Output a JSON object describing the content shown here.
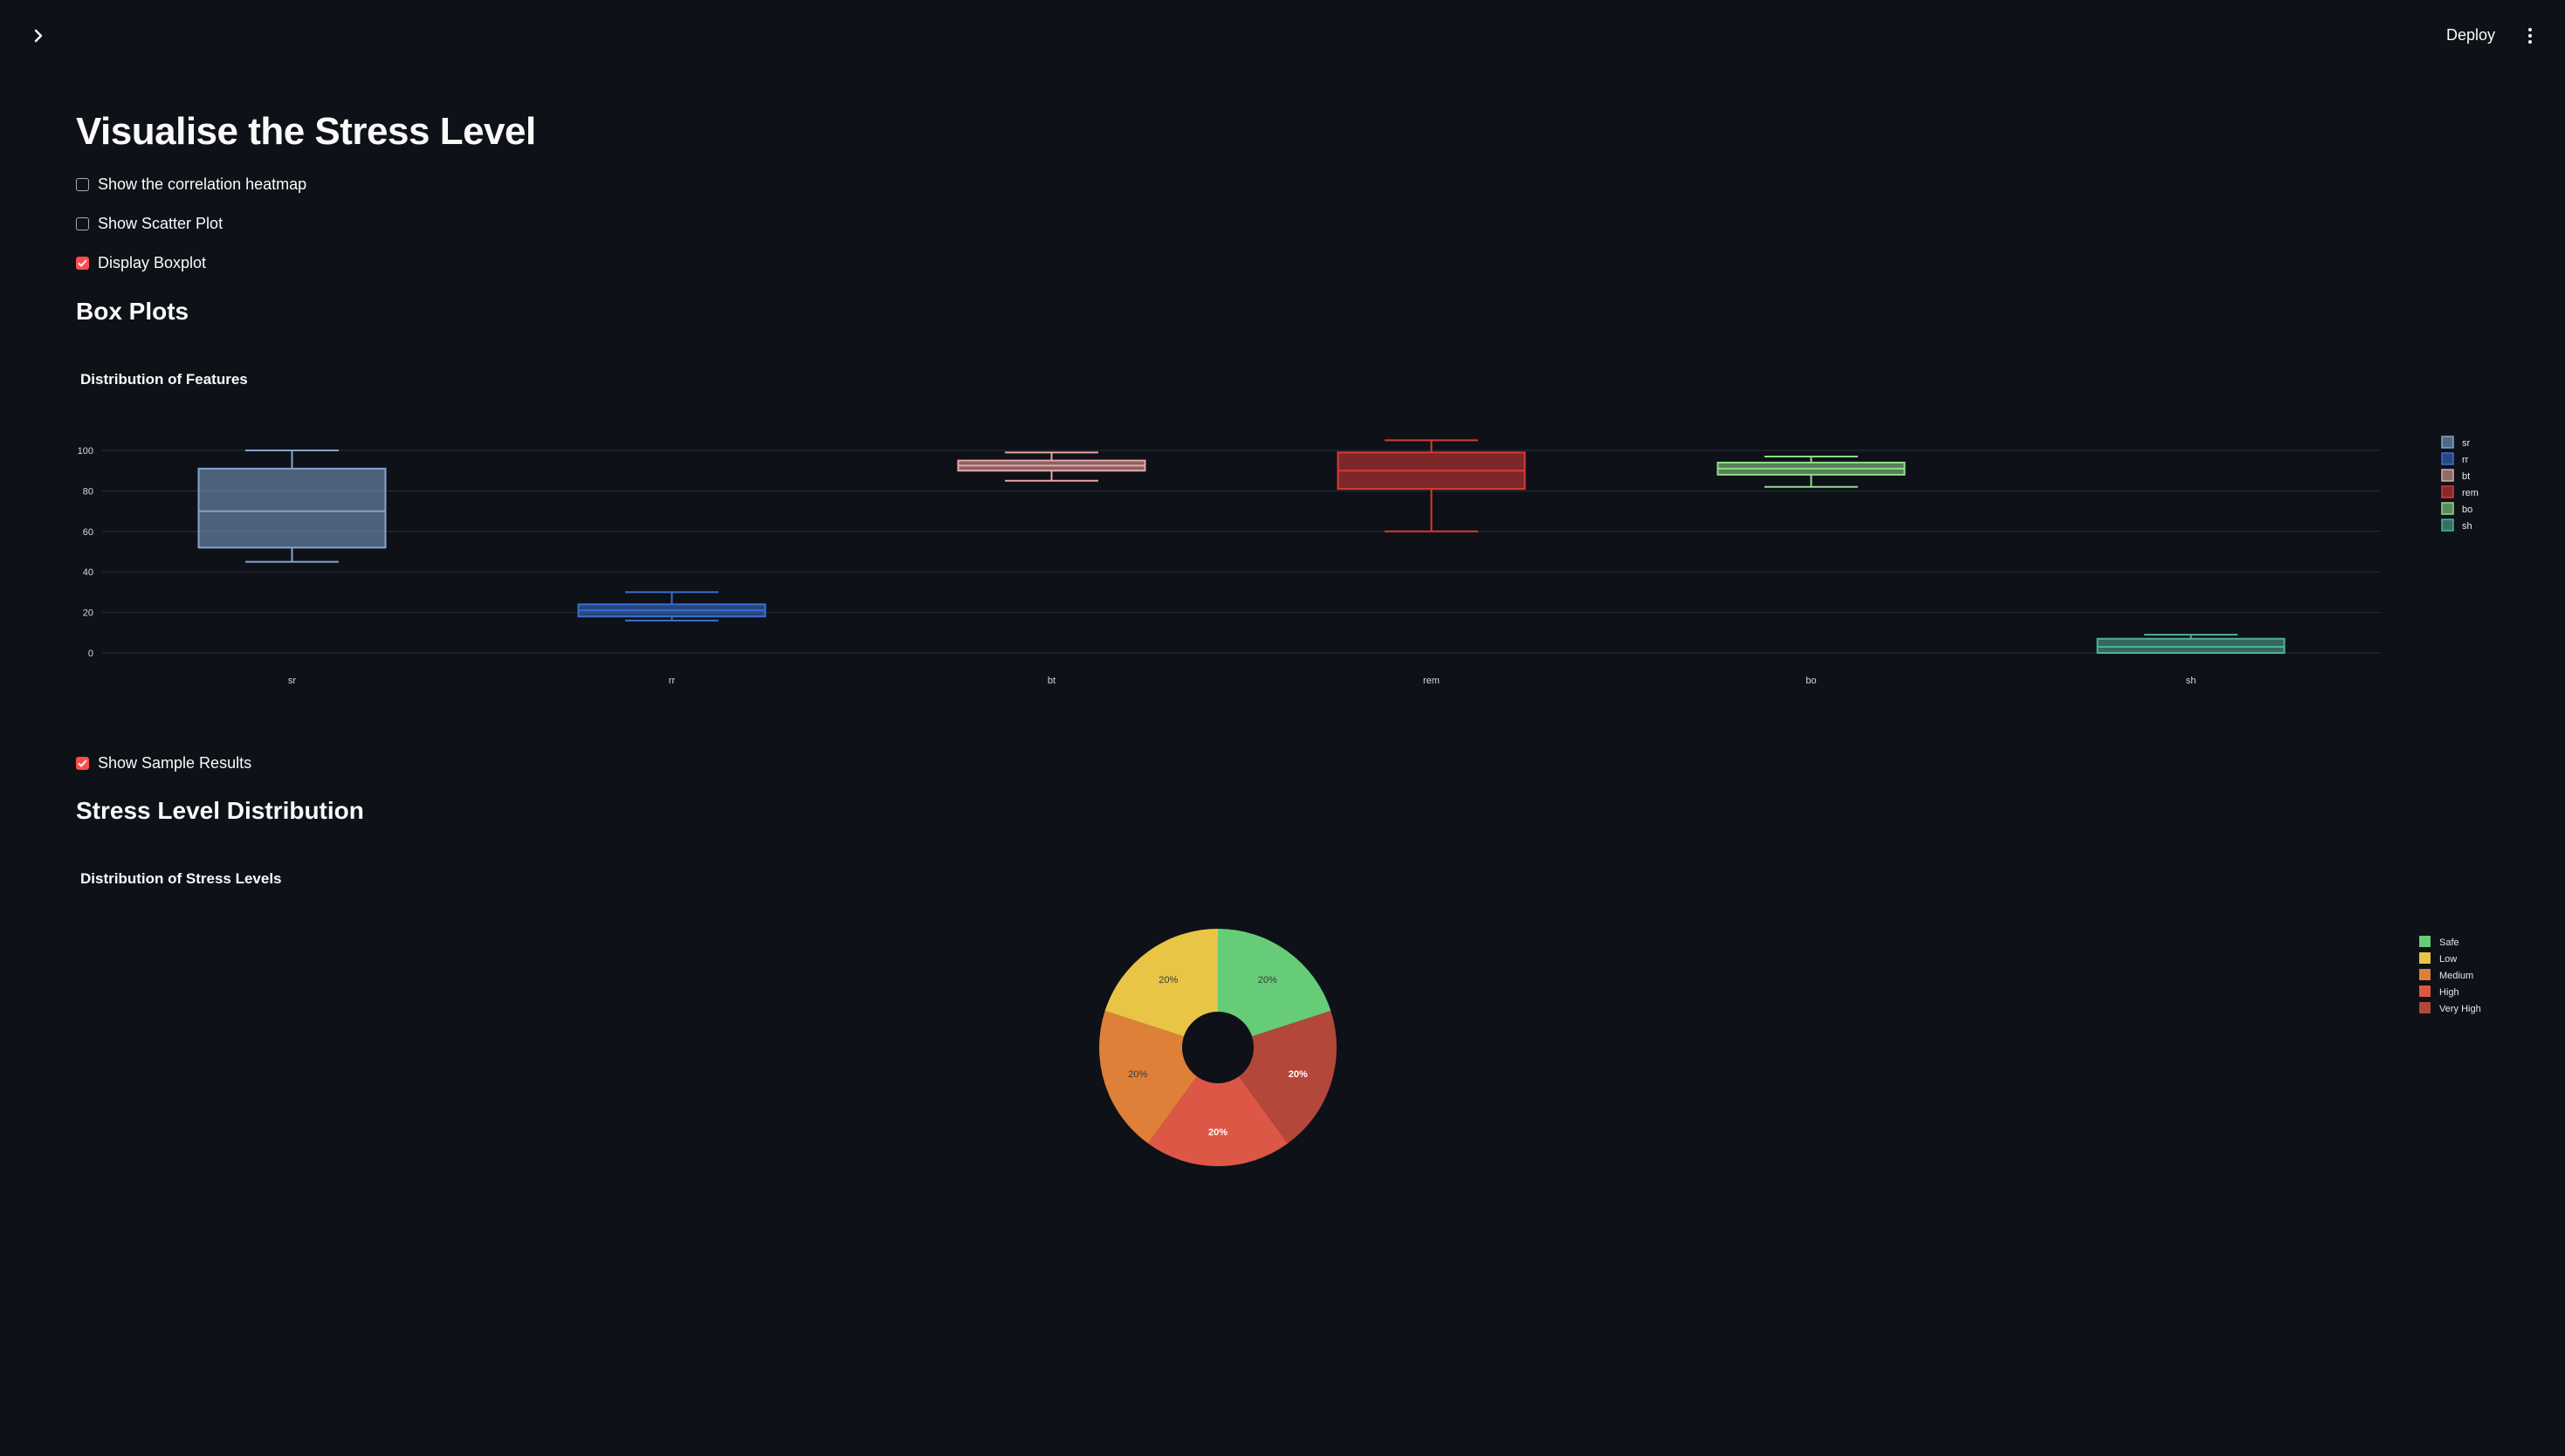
{
  "header": {
    "deploy_label": "Deploy"
  },
  "page": {
    "title": "Visualise the Stress Level"
  },
  "controls": {
    "heatmap_label": "Show the correlation heatmap",
    "heatmap_checked": false,
    "scatter_label": "Show Scatter Plot",
    "scatter_checked": false,
    "boxplot_label": "Display Boxplot",
    "boxplot_checked": true,
    "sample_label": "Show Sample Results",
    "sample_checked": true
  },
  "sections": {
    "box_heading": "Box Plots",
    "pie_heading": "Stress Level Distribution"
  },
  "chart_data": [
    {
      "type": "box",
      "title": "Distribution of Features",
      "ylim": [
        0,
        100
      ],
      "yticks": [
        0,
        20,
        40,
        60,
        80,
        100
      ],
      "grid": true,
      "legend": "right",
      "series": [
        {
          "name": "sr",
          "min": 45,
          "q1": 52,
          "median": 70,
          "q3": 91,
          "max": 100,
          "color": "#83a4cf"
        },
        {
          "name": "rr",
          "min": 16,
          "q1": 18,
          "median": 21,
          "q3": 24,
          "max": 30,
          "color": "#3a6fd0"
        },
        {
          "name": "bt",
          "min": 85,
          "q1": 90,
          "median": 92.5,
          "q3": 95,
          "max": 99,
          "color": "#eaa6a3"
        },
        {
          "name": "rem",
          "min": 60,
          "q1": 81,
          "median": 90,
          "q3": 99,
          "max": 105,
          "color": "#d83a36"
        },
        {
          "name": "bo",
          "min": 82,
          "q1": 88,
          "median": 91,
          "q3": 94,
          "max": 97,
          "color": "#8fdc8a"
        },
        {
          "name": "sh",
          "min": 0,
          "q1": 0,
          "median": 3,
          "q3": 7,
          "max": 9,
          "color": "#4fb29a"
        }
      ]
    },
    {
      "type": "pie",
      "title": "Distribution of Stress Levels",
      "legend": "right",
      "slices": [
        {
          "label": "Safe",
          "value": 20,
          "text": "20%",
          "color": "#66cc77"
        },
        {
          "label": "Very High",
          "value": 20,
          "text": "20%",
          "color": "#b3473a"
        },
        {
          "label": "High",
          "value": 20,
          "text": "20%",
          "color": "#dd5747"
        },
        {
          "label": "Medium",
          "value": 20,
          "text": "20%",
          "color": "#de8038"
        },
        {
          "label": "Low",
          "value": 20,
          "text": "20%",
          "color": "#e8c545"
        }
      ],
      "legend_order": [
        "Safe",
        "Low",
        "Medium",
        "High",
        "Very High"
      ]
    }
  ]
}
